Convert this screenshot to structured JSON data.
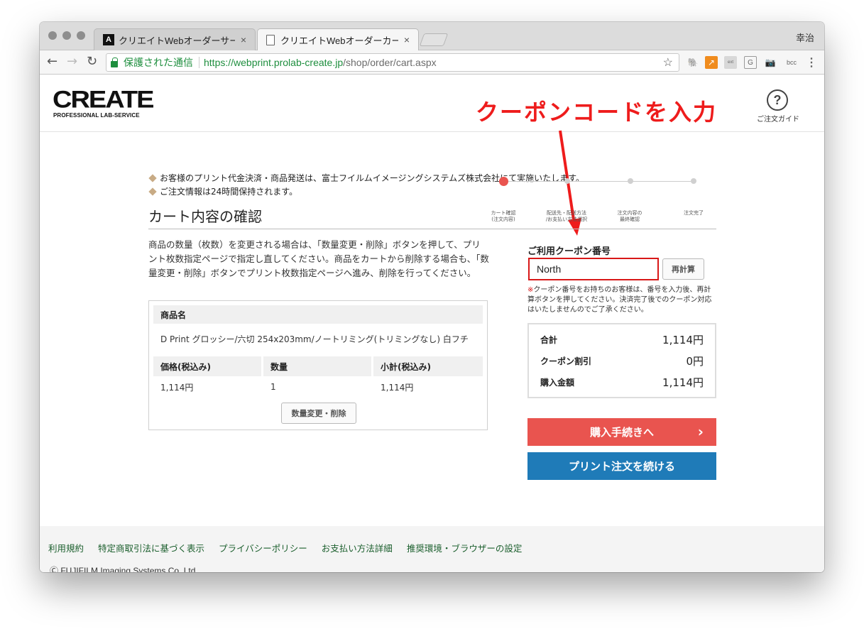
{
  "browser": {
    "tabs": [
      {
        "title": "クリエイトWebオーダーサービ",
        "close": "×"
      },
      {
        "title": "クリエイトWebオーダーカート",
        "close": "×"
      }
    ],
    "profile_name": "幸治",
    "security_label": "保護された通信",
    "url_base": "https://webprint.prolab-create.jp",
    "url_path": "/shop/order/cart.aspx",
    "extensions": [
      "evernote-icon",
      "chart-icon",
      "ext-icon",
      "g-icon",
      "camera-icon",
      "bcc"
    ]
  },
  "header": {
    "logo_main": "CREATE",
    "logo_sub": "PROFESSIONAL LAB-SERVICE",
    "help_glyph": "?",
    "help_label": "ご注文ガイド"
  },
  "annotation": {
    "text": "クーポンコードを入力",
    "color": "#ee1c1c"
  },
  "notices": [
    "お客様のプリント代金決済・商品発送は、富士フイルムイメージングシステムズ株式会社にて実施いたします。",
    "ご注文情報は24時間保持されます。"
  ],
  "page_title": "カート内容の確認",
  "progress": {
    "steps": [
      {
        "line1": "カート確認",
        "line2": "(注文内容)"
      },
      {
        "line1": "配送先・配送方法",
        "line2": "/お支払い方法選択"
      },
      {
        "line1": "注文内容の",
        "line2": "最終確認"
      },
      {
        "line1": "注文完了",
        "line2": ""
      }
    ],
    "current_step": 1
  },
  "description": "商品の数量（枚数）を変更される場合は、「数量変更・削除」ボタンを押して、プリント枚数指定ページで指定し直してください。商品をカートから削除する場合も、「数量変更・削除」ボタンでプリント枚数指定ページへ進み、削除を行ってください。",
  "product": {
    "name_header": "商品名",
    "name": "D Print グロッシー/六切 254x203mm/ノートリミング(トリミングなし) 白フチ",
    "columns": [
      "価格(税込み)",
      "数量",
      "小計(税込み)"
    ],
    "values": [
      "1,114円",
      "1",
      "1,114円"
    ],
    "qty_button": "数量変更・削除"
  },
  "coupon": {
    "label": "ご利用クーポン番号",
    "value": "North",
    "recalc_button": "再計算",
    "note_mark": "※",
    "note": "クーポン番号をお持ちのお客様は、番号を入力後、再計算ボタンを押してください。決済完了後でのクーポン対応はいたしませんのでご了承ください。"
  },
  "summary": [
    {
      "label": "合計",
      "value": "1,114円"
    },
    {
      "label": "クーポン割引",
      "value": "0円"
    },
    {
      "label": "購入金額",
      "value": "1,114円"
    }
  ],
  "actions": {
    "checkout": "購入手続きへ",
    "checkout_chevron": "›",
    "continue": "プリント注文を続ける"
  },
  "footer": {
    "links": [
      "利用規約",
      "特定商取引法に基づく表示",
      "プライバシーポリシー",
      "お支払い方法詳細",
      "推奨環境・ブラウザーの設定"
    ],
    "copyright": "Ⓒ FUJIFILM Imaging Systems Co.,Ltd."
  },
  "colors": {
    "accent_red": "#e9544f",
    "accent_blue": "#1f7bb8",
    "link_green": "#1a5e2c",
    "coupon_border": "#d81818"
  }
}
